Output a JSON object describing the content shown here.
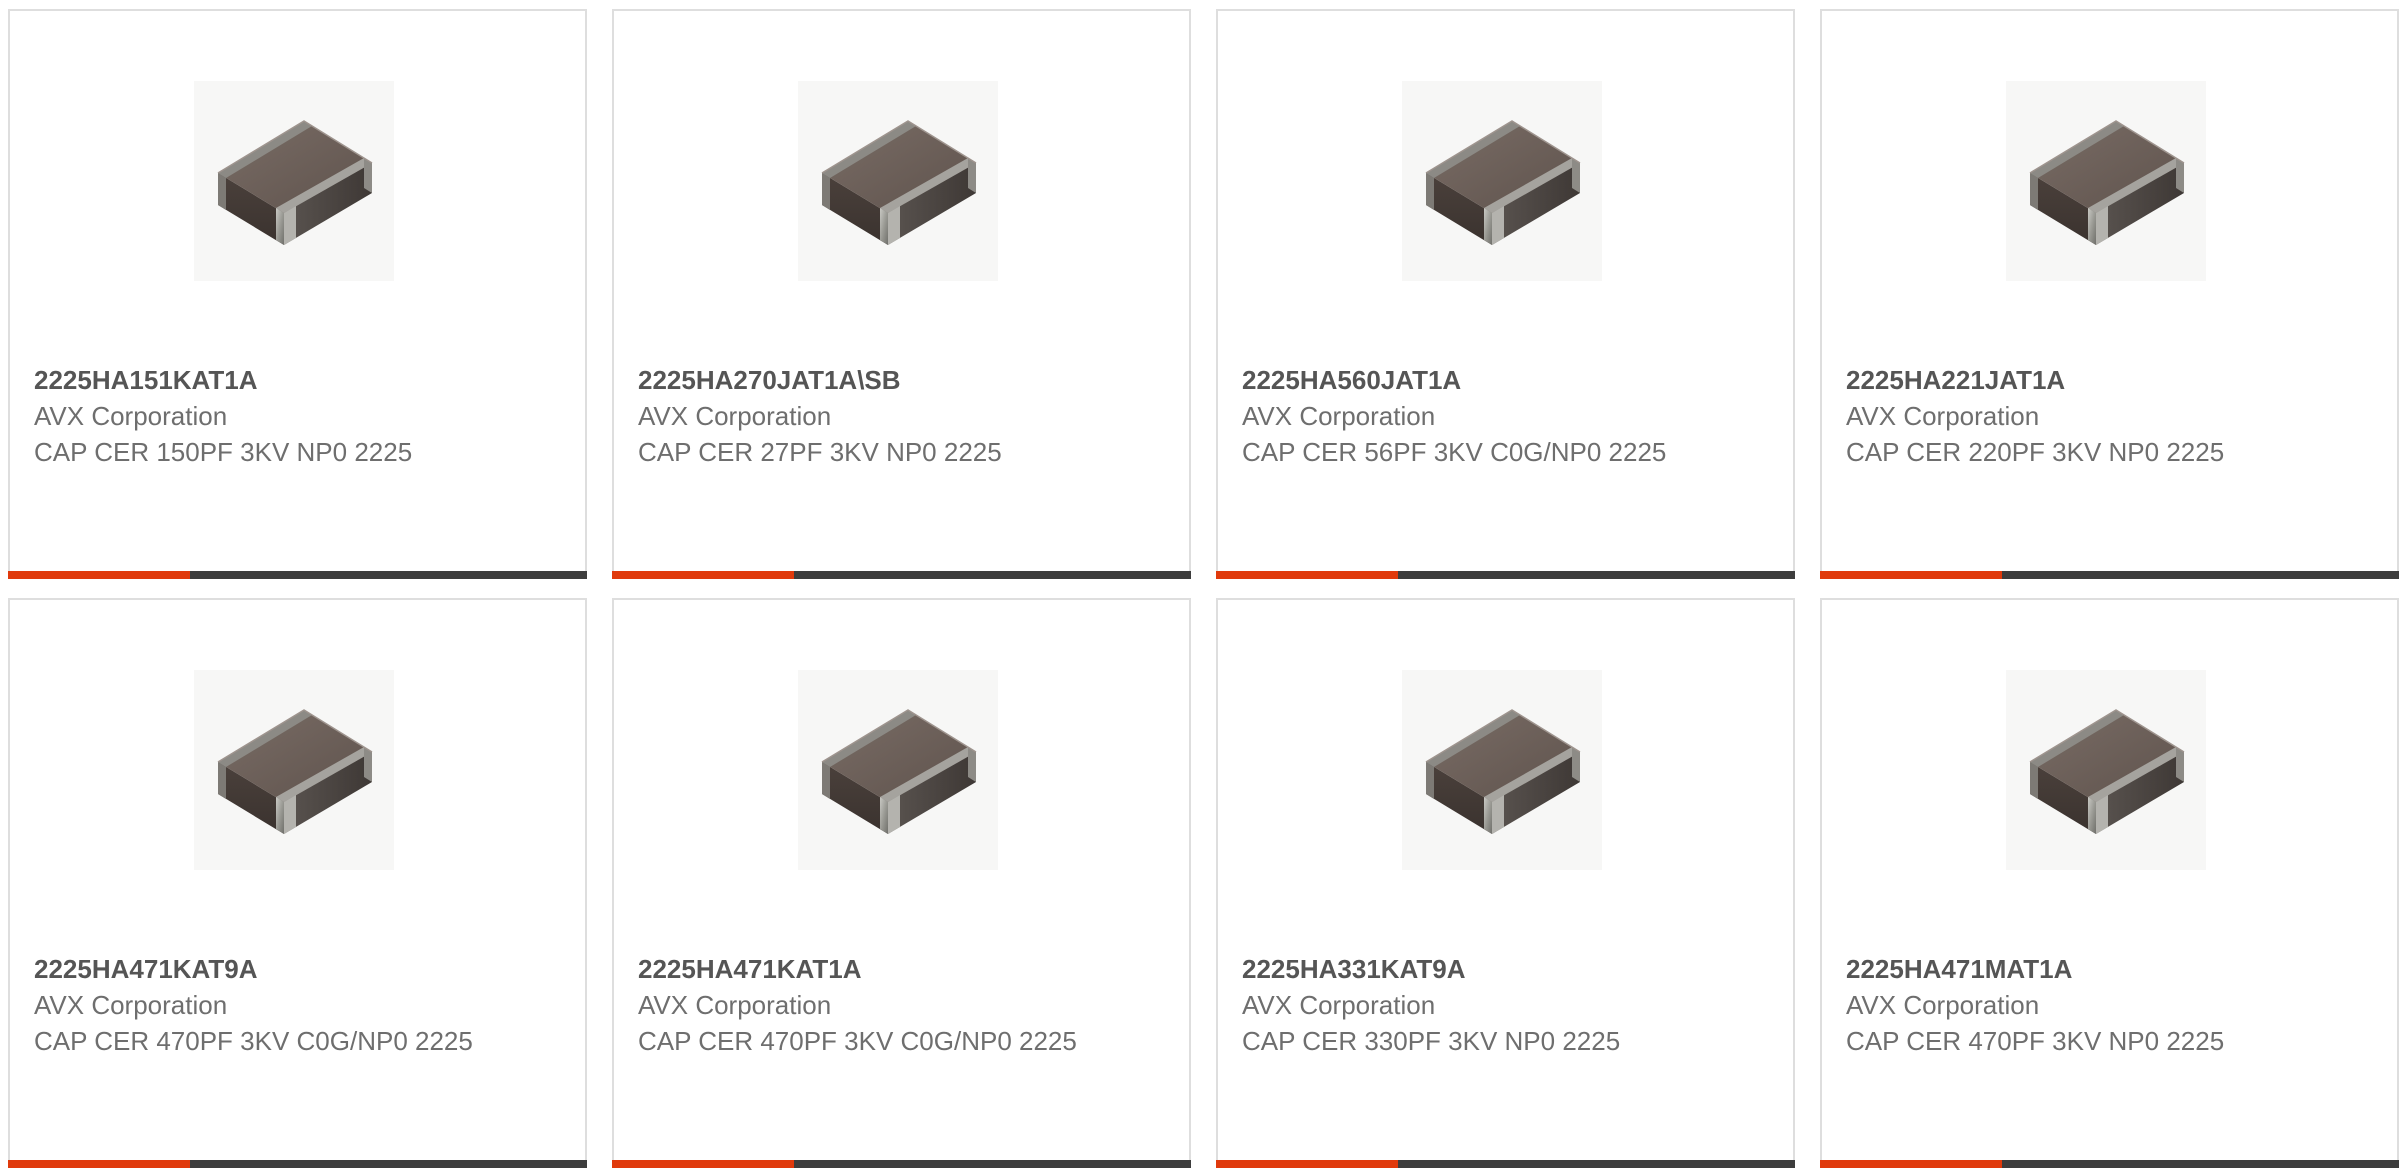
{
  "colors": {
    "accent": "#e03a0c",
    "bar": "#3d3d3d",
    "border": "#dedede"
  },
  "products": [
    {
      "part_number": "2225HA151KAT1A",
      "manufacturer": "AVX Corporation",
      "description": "CAP CER 150PF 3KV NP0 2225",
      "image_icon": "ceramic-capacitor-image"
    },
    {
      "part_number": "2225HA270JAT1A\\SB",
      "manufacturer": "AVX Corporation",
      "description": "CAP CER 27PF 3KV NP0 2225",
      "image_icon": "ceramic-capacitor-image"
    },
    {
      "part_number": "2225HA560JAT1A",
      "manufacturer": "AVX Corporation",
      "description": "CAP CER 56PF 3KV C0G/NP0 2225",
      "image_icon": "ceramic-capacitor-image"
    },
    {
      "part_number": "2225HA221JAT1A",
      "manufacturer": "AVX Corporation",
      "description": "CAP CER 220PF 3KV NP0 2225",
      "image_icon": "ceramic-capacitor-image"
    },
    {
      "part_number": "2225HA471KAT9A",
      "manufacturer": "AVX Corporation",
      "description": "CAP CER 470PF 3KV C0G/NP0 2225",
      "image_icon": "ceramic-capacitor-image"
    },
    {
      "part_number": "2225HA471KAT1A",
      "manufacturer": "AVX Corporation",
      "description": "CAP CER 470PF 3KV C0G/NP0 2225",
      "image_icon": "ceramic-capacitor-image"
    },
    {
      "part_number": "2225HA331KAT9A",
      "manufacturer": "AVX Corporation",
      "description": "CAP CER 330PF 3KV NP0 2225",
      "image_icon": "ceramic-capacitor-image"
    },
    {
      "part_number": "2225HA471MAT1A",
      "manufacturer": "AVX Corporation",
      "description": "CAP CER 470PF 3KV NP0 2225",
      "image_icon": "ceramic-capacitor-image"
    }
  ]
}
